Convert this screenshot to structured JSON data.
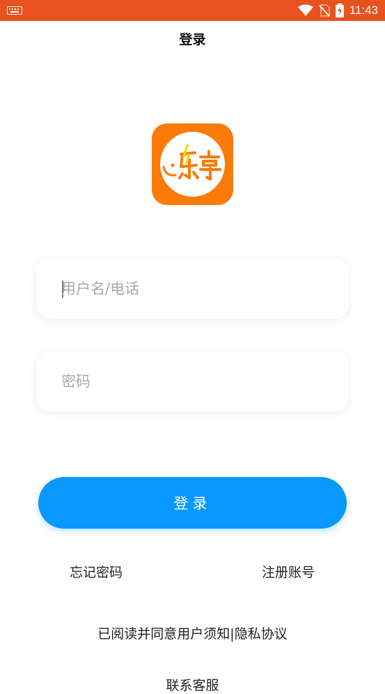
{
  "status_bar": {
    "time": "11:43",
    "icons": [
      "keyboard-icon",
      "wifi-icon",
      "no-sim-icon",
      "battery-charging-icon"
    ]
  },
  "header": {
    "title": "登录"
  },
  "logo": {
    "text": "乐享",
    "colors": {
      "background": "#fa7b07",
      "inner": "#ffffff"
    }
  },
  "form": {
    "username": {
      "value": "",
      "placeholder": "用户名/电话"
    },
    "password": {
      "value": "",
      "placeholder": "密码"
    }
  },
  "login_button": {
    "label": "登录"
  },
  "links": {
    "forgot": "忘记密码",
    "register": "注册账号"
  },
  "agreement": {
    "prefix": "已阅读并同意",
    "user_terms": "用户须知",
    "separator": "|",
    "privacy": "隐私协议"
  },
  "contact": {
    "label": "联系客服"
  },
  "colors": {
    "status_bar": "#e8521e",
    "primary": "#0a97ff"
  }
}
